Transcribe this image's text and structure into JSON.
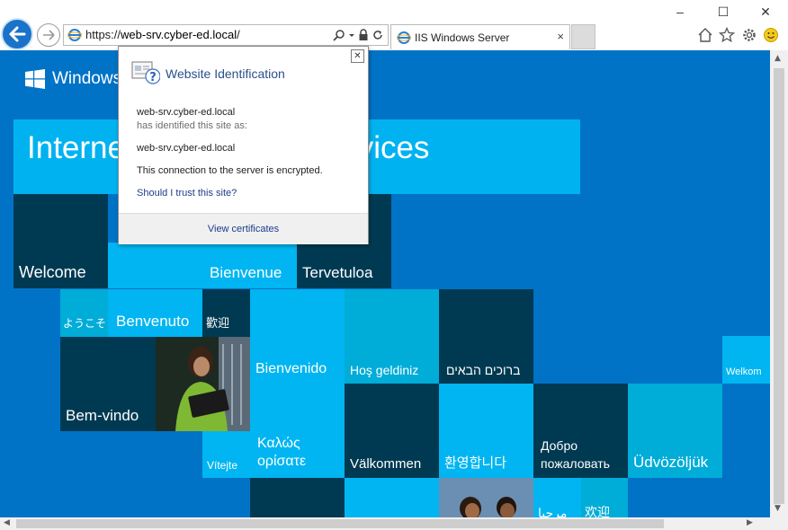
{
  "browser": {
    "address_scheme": "https://",
    "address_host": "web-srv.cyber-ed.local",
    "address_path": "/",
    "tab_title": "IIS Windows Server",
    "tab_close": "×",
    "window_controls": {
      "minimize": "–",
      "maximize": "☐",
      "close": "✕"
    }
  },
  "page": {
    "logo_text": "Windows",
    "banner_title": "Internet Information Services",
    "tiles": [
      "Welcome",
      "Bienvenue",
      "Tervetuloa",
      "ようこそ",
      "Benvenuto",
      "歡迎",
      "Bienvenido",
      "Hoş geldiniz",
      "ברוכים הבאים",
      "Welkom",
      "Bem-vindo",
      "Vítejte",
      "Καλώς\nορίσατε",
      "Välkommen",
      "환영합니다",
      "Добро\nпожаловать",
      "Üdvözöljük",
      "مرحبا",
      "欢迎"
    ]
  },
  "popup": {
    "title": "Website Identification",
    "close": "✕",
    "site": "web-srv.cyber-ed.local",
    "identified_by": "has identified this site as:",
    "identity": "web-srv.cyber-ed.local",
    "encryption": "This connection to the server is encrypted.",
    "trust_link": "Should I trust this site?",
    "view_certificates": "View certificates"
  },
  "colors": {
    "page_blue": "#0173c7",
    "tile_dark": "#003a52",
    "tile_cyan": "#00b5f1",
    "link_blue": "#1c3c8a"
  }
}
